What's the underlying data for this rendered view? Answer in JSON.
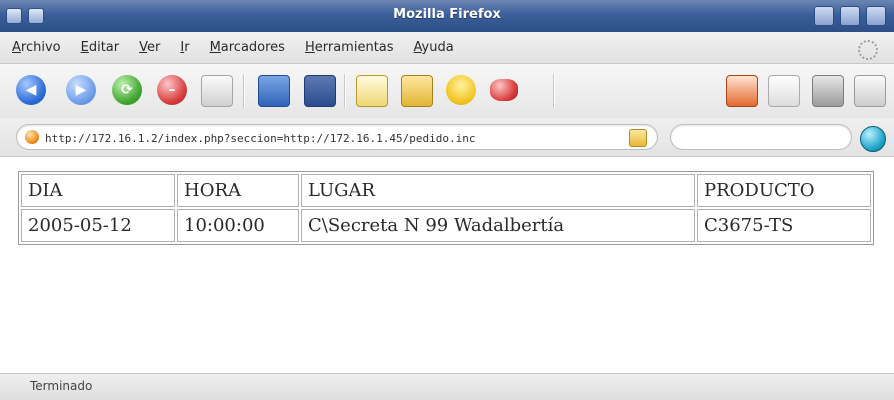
{
  "window": {
    "title": "Mozilla Firefox"
  },
  "menubar": {
    "items": [
      "Archivo",
      "Editar",
      "Ver",
      "Ir",
      "Marcadores",
      "Herramientas",
      "Ayuda"
    ]
  },
  "toolbar": {
    "icons": [
      "back-icon",
      "forward-icon",
      "reload-icon",
      "stop-icon",
      "home-icon",
      "new-tab-icon",
      "new-window-icon",
      "fullscreen-icon",
      "edit-icon",
      "bulb-icon",
      "chat-icon",
      "print-icon",
      "paste-icon",
      "mic-icon",
      "plugin-icon"
    ]
  },
  "location": {
    "url": "http://172.16.1.2/index.php?seccion=http://172.16.1.45/pedido.inc",
    "search_value": ""
  },
  "table": {
    "headers": [
      "DIA",
      "HORA",
      "LUGAR",
      "PRODUCTO"
    ],
    "rows": [
      [
        "2005-05-12",
        "10:00:00",
        "C\\Secreta N 99 Wadalbertía",
        "C3675-TS"
      ]
    ]
  },
  "status": {
    "text": "Terminado"
  }
}
